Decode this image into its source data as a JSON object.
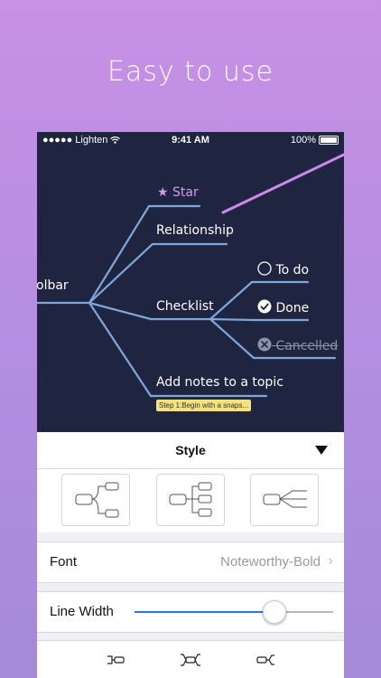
{
  "headline": "Easy to use",
  "status": {
    "carrier": "●●●●● Lighten",
    "time": "9:41 AM",
    "battery": "100%"
  },
  "mindmap": {
    "root": "olbar",
    "topics": {
      "star": "Star",
      "relationship": "Relationship",
      "checklist": "Checklist",
      "todo": "To do",
      "done": "Done",
      "cancelled": "Cancelled",
      "notes": "Add notes to a topic",
      "note_chip": "Step 1:Begin with a snaps..."
    },
    "colors": {
      "canvas": "#1f2540",
      "branch": "#7fa7d8",
      "relationship_line": "#c98ae8",
      "star": "#d49af0"
    }
  },
  "panel": {
    "style_title": "Style",
    "font_label": "Font",
    "font_value": "Noteworthy-Bold",
    "line_width_label": "Line Width",
    "line_width_fraction": 0.7,
    "slider_color": "#1e7cf0"
  }
}
